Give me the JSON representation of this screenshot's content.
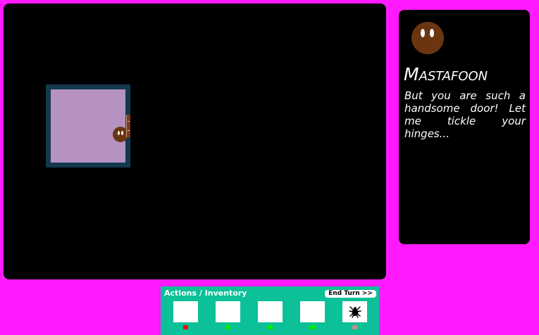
{
  "dialog": {
    "speaker_name": "Mastafoon",
    "speech": "But you are such a handsome door! Let me tickle your hinges...",
    "portrait_icon": "brown-creature-face-icon"
  },
  "map": {
    "room_floor_color": "#b592c1",
    "room_wall_color": "#12394d",
    "player_icon": "brown-creature-face-icon",
    "door_icon": "door-icon"
  },
  "action_bar": {
    "title": "Actions / Inventory",
    "end_turn_label": "End Turn >>",
    "slots": [
      {
        "icon": "empty",
        "indicator_color": "#ff0000"
      },
      {
        "icon": "empty",
        "indicator_color": "#00ee00"
      },
      {
        "icon": "empty",
        "indicator_color": "#00ee00"
      },
      {
        "icon": "empty",
        "indicator_color": "#00ee00"
      },
      {
        "icon": "spider-icon",
        "indicator_color": "#c09090"
      }
    ]
  },
  "colors": {
    "background": "#ff1aff",
    "panel": "#000000",
    "action_bar": "#0cc097",
    "creature": "#6a3510"
  }
}
